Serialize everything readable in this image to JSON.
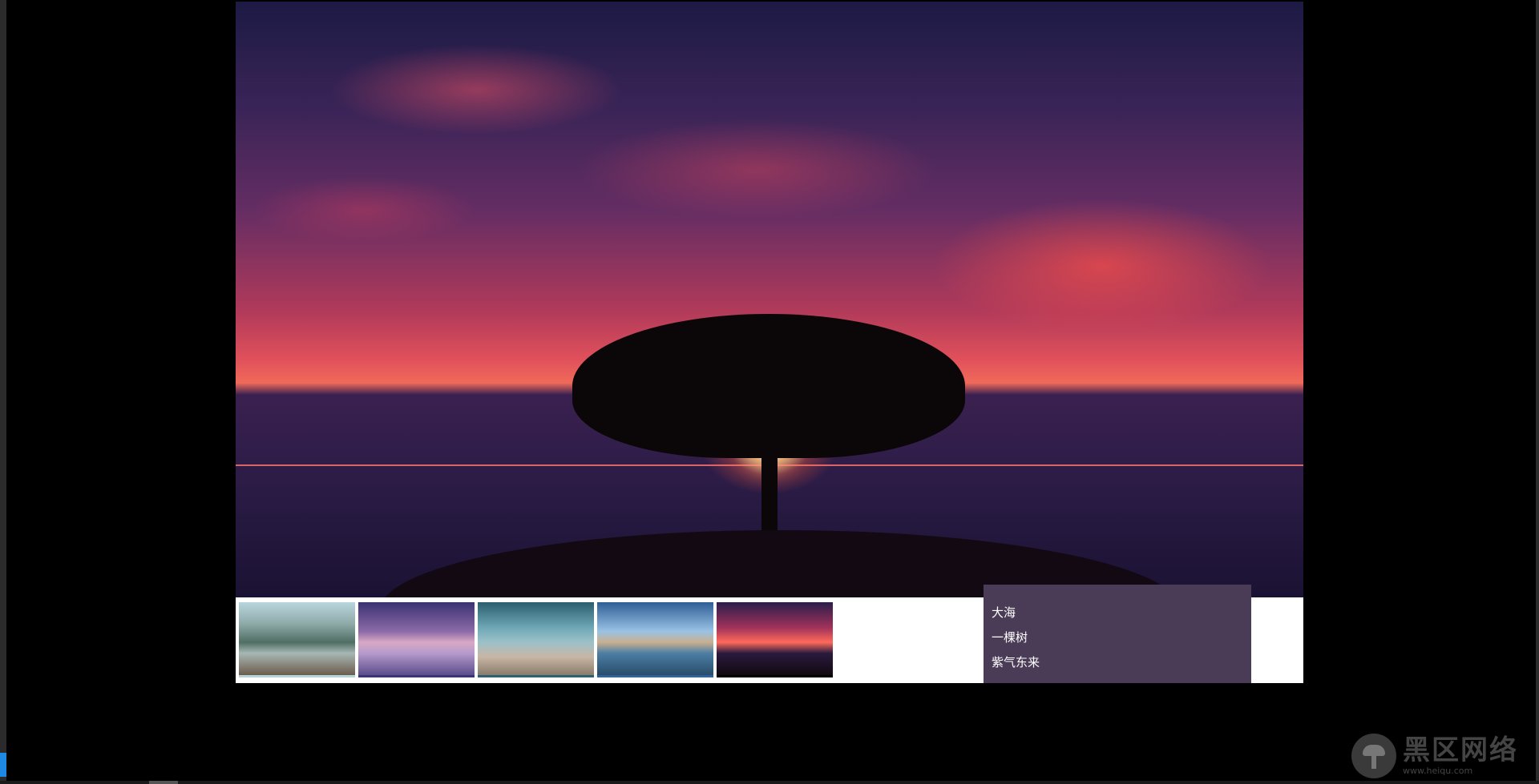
{
  "slider": {
    "thumbnails": [
      {
        "icon": "mountain-lake-dock"
      },
      {
        "icon": "lone-tree-purple-sky"
      },
      {
        "icon": "beach-walker"
      },
      {
        "icon": "mountain-lake-reflection"
      },
      {
        "icon": "tree-sunset-sea",
        "active": true
      }
    ],
    "captions": [
      "大海",
      "一棵树",
      "紫气东来"
    ]
  },
  "watermark": {
    "title": "黑区网络",
    "url": "www.heiqu.com"
  },
  "colors": {
    "caption_panel_bg": "#4a3c56",
    "page_bg": "#000000",
    "slider_bg": "#ffffff"
  }
}
